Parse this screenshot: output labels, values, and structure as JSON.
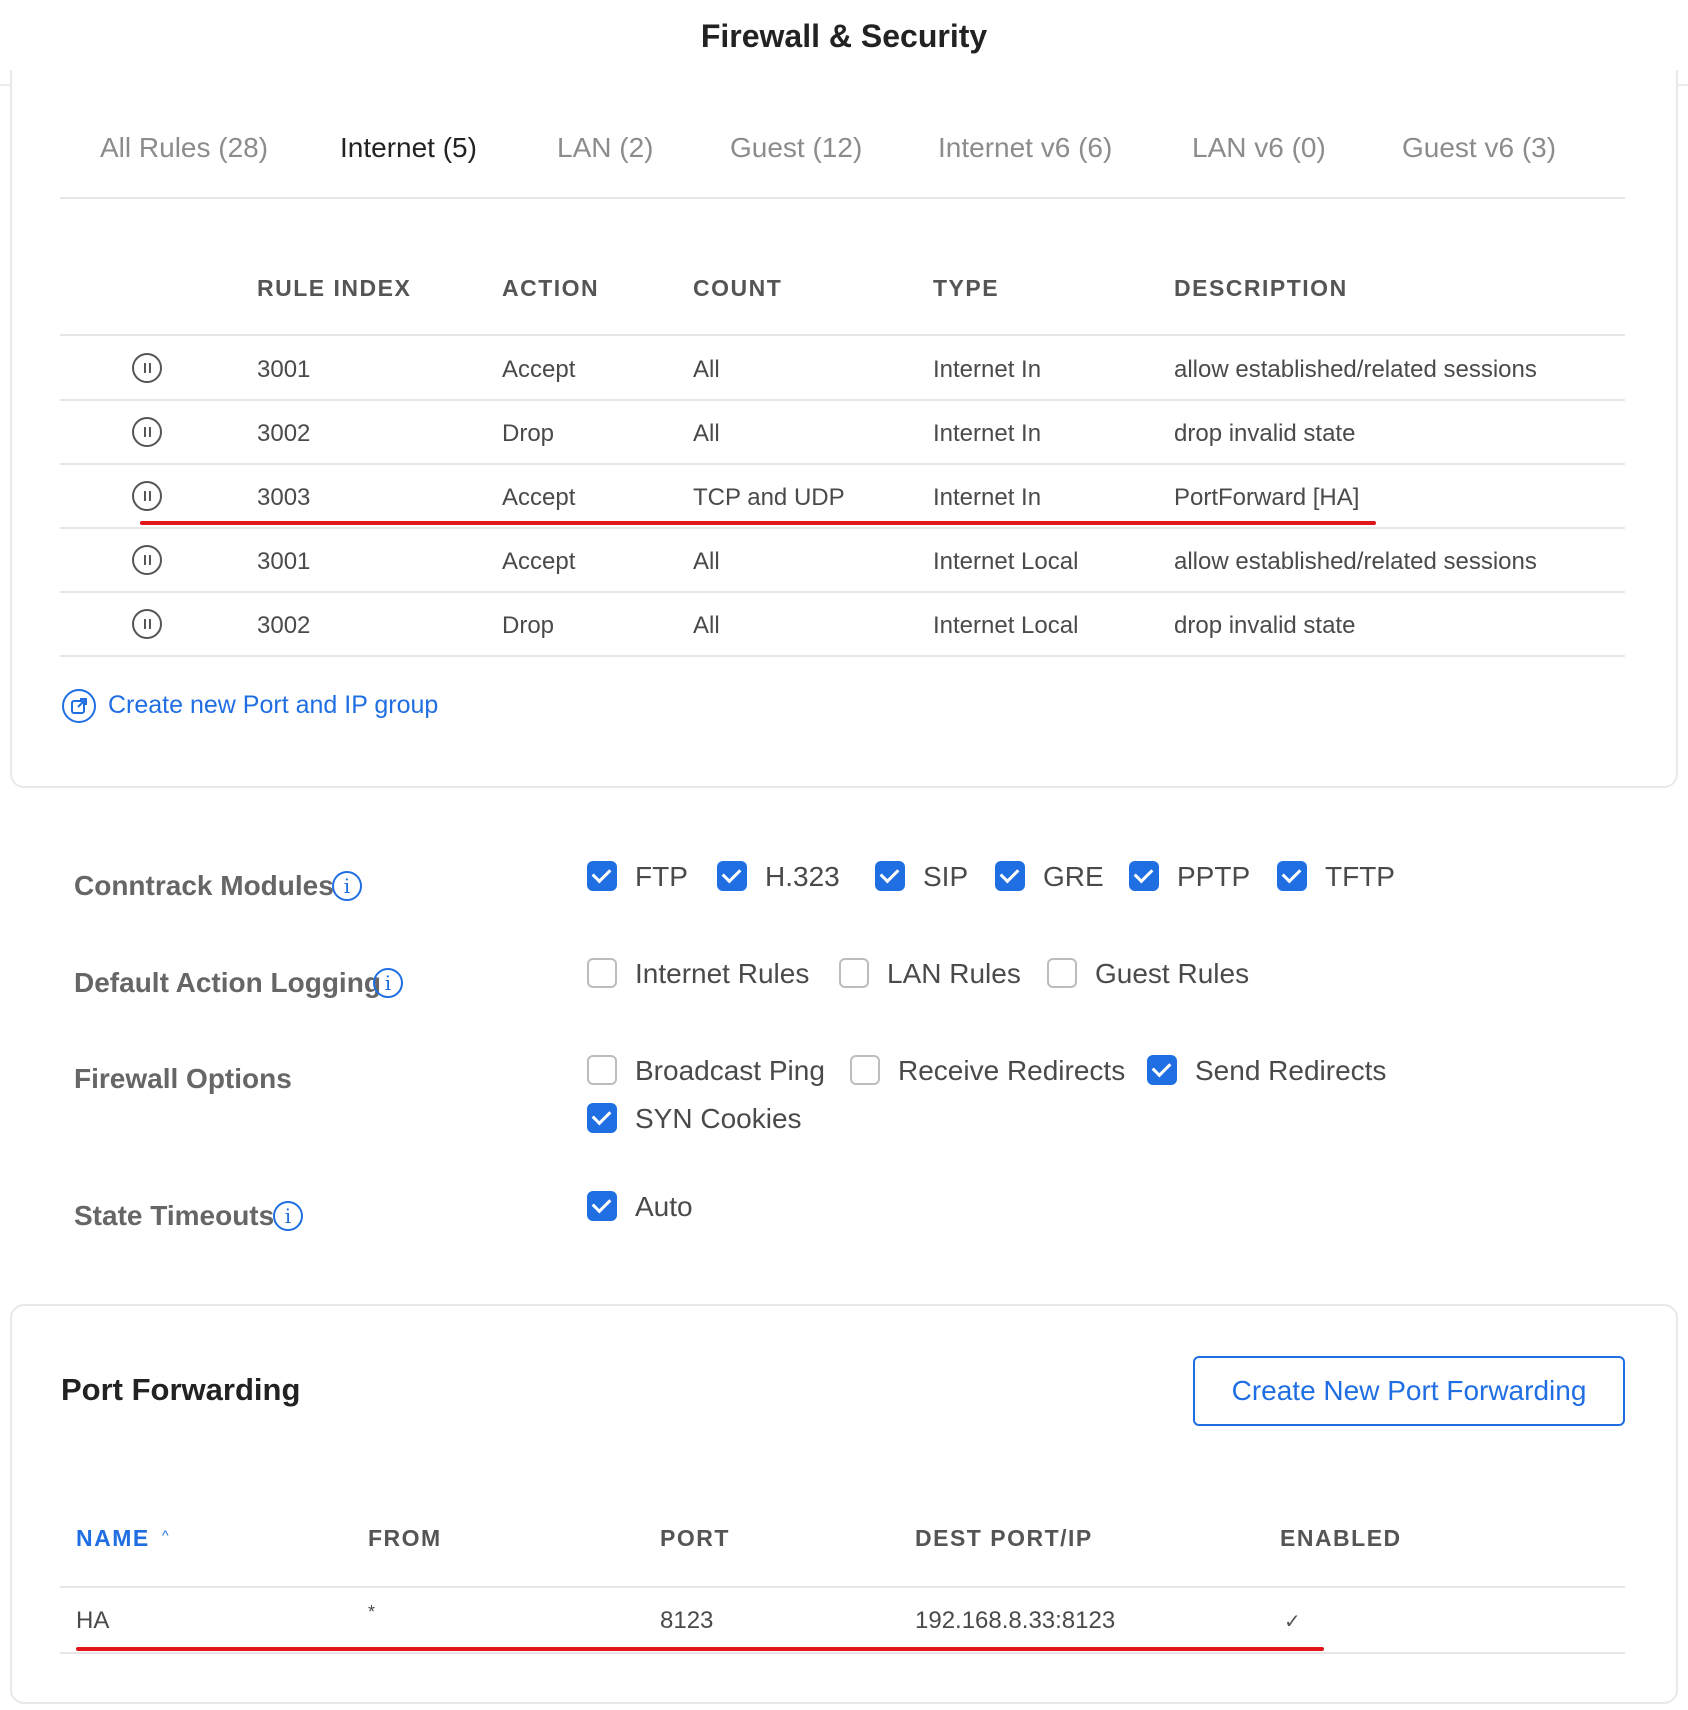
{
  "header": {
    "title": "Firewall & Security"
  },
  "tabs": [
    {
      "label": "All Rules (28)",
      "active": false
    },
    {
      "label": "Internet (5)",
      "active": true
    },
    {
      "label": "LAN (2)",
      "active": false
    },
    {
      "label": "Guest (12)",
      "active": false
    },
    {
      "label": "Internet v6 (6)",
      "active": false
    },
    {
      "label": "LAN v6 (0)",
      "active": false
    },
    {
      "label": "Guest v6 (3)",
      "active": false
    }
  ],
  "rules_table": {
    "columns": [
      "RULE INDEX",
      "ACTION",
      "COUNT",
      "TYPE",
      "DESCRIPTION"
    ],
    "rows": [
      {
        "index": "3001",
        "action": "Accept",
        "count": "All",
        "type": "Internet In",
        "description": "allow established/related sessions"
      },
      {
        "index": "3002",
        "action": "Drop",
        "count": "All",
        "type": "Internet In",
        "description": "drop invalid state"
      },
      {
        "index": "3003",
        "action": "Accept",
        "count": "TCP and UDP",
        "type": "Internet In",
        "description": "PortForward [HA]"
      },
      {
        "index": "3001",
        "action": "Accept",
        "count": "All",
        "type": "Internet Local",
        "description": "allow established/related sessions"
      },
      {
        "index": "3002",
        "action": "Drop",
        "count": "All",
        "type": "Internet Local",
        "description": "drop invalid state"
      }
    ]
  },
  "create_group_link": "Create new Port and IP group",
  "settings": {
    "conntrack": {
      "label": "Conntrack Modules",
      "options": [
        {
          "label": "FTP",
          "checked": true
        },
        {
          "label": "H.323",
          "checked": true
        },
        {
          "label": "SIP",
          "checked": true
        },
        {
          "label": "GRE",
          "checked": true
        },
        {
          "label": "PPTP",
          "checked": true
        },
        {
          "label": "TFTP",
          "checked": true
        }
      ]
    },
    "logging": {
      "label": "Default Action Logging",
      "options": [
        {
          "label": "Internet Rules",
          "checked": false
        },
        {
          "label": "LAN Rules",
          "checked": false
        },
        {
          "label": "Guest Rules",
          "checked": false
        }
      ]
    },
    "firewall_options": {
      "label": "Firewall Options",
      "options": [
        {
          "label": "Broadcast Ping",
          "checked": false
        },
        {
          "label": "Receive Redirects",
          "checked": false
        },
        {
          "label": "Send Redirects",
          "checked": true
        },
        {
          "label": "SYN Cookies",
          "checked": true
        }
      ]
    },
    "state_timeouts": {
      "label": "State Timeouts",
      "options": [
        {
          "label": "Auto",
          "checked": true
        }
      ]
    }
  },
  "port_forwarding": {
    "title": "Port Forwarding",
    "create_button": "Create New Port Forwarding",
    "columns": [
      "NAME",
      "FROM",
      "PORT",
      "DEST PORT/IP",
      "ENABLED"
    ],
    "rows": [
      {
        "name": "HA",
        "from": "*",
        "port": "8123",
        "dest": "192.168.8.33:8123",
        "enabled": "✓"
      }
    ]
  },
  "colors": {
    "accent": "#1f6fe3",
    "highlight": "#e0161b"
  }
}
